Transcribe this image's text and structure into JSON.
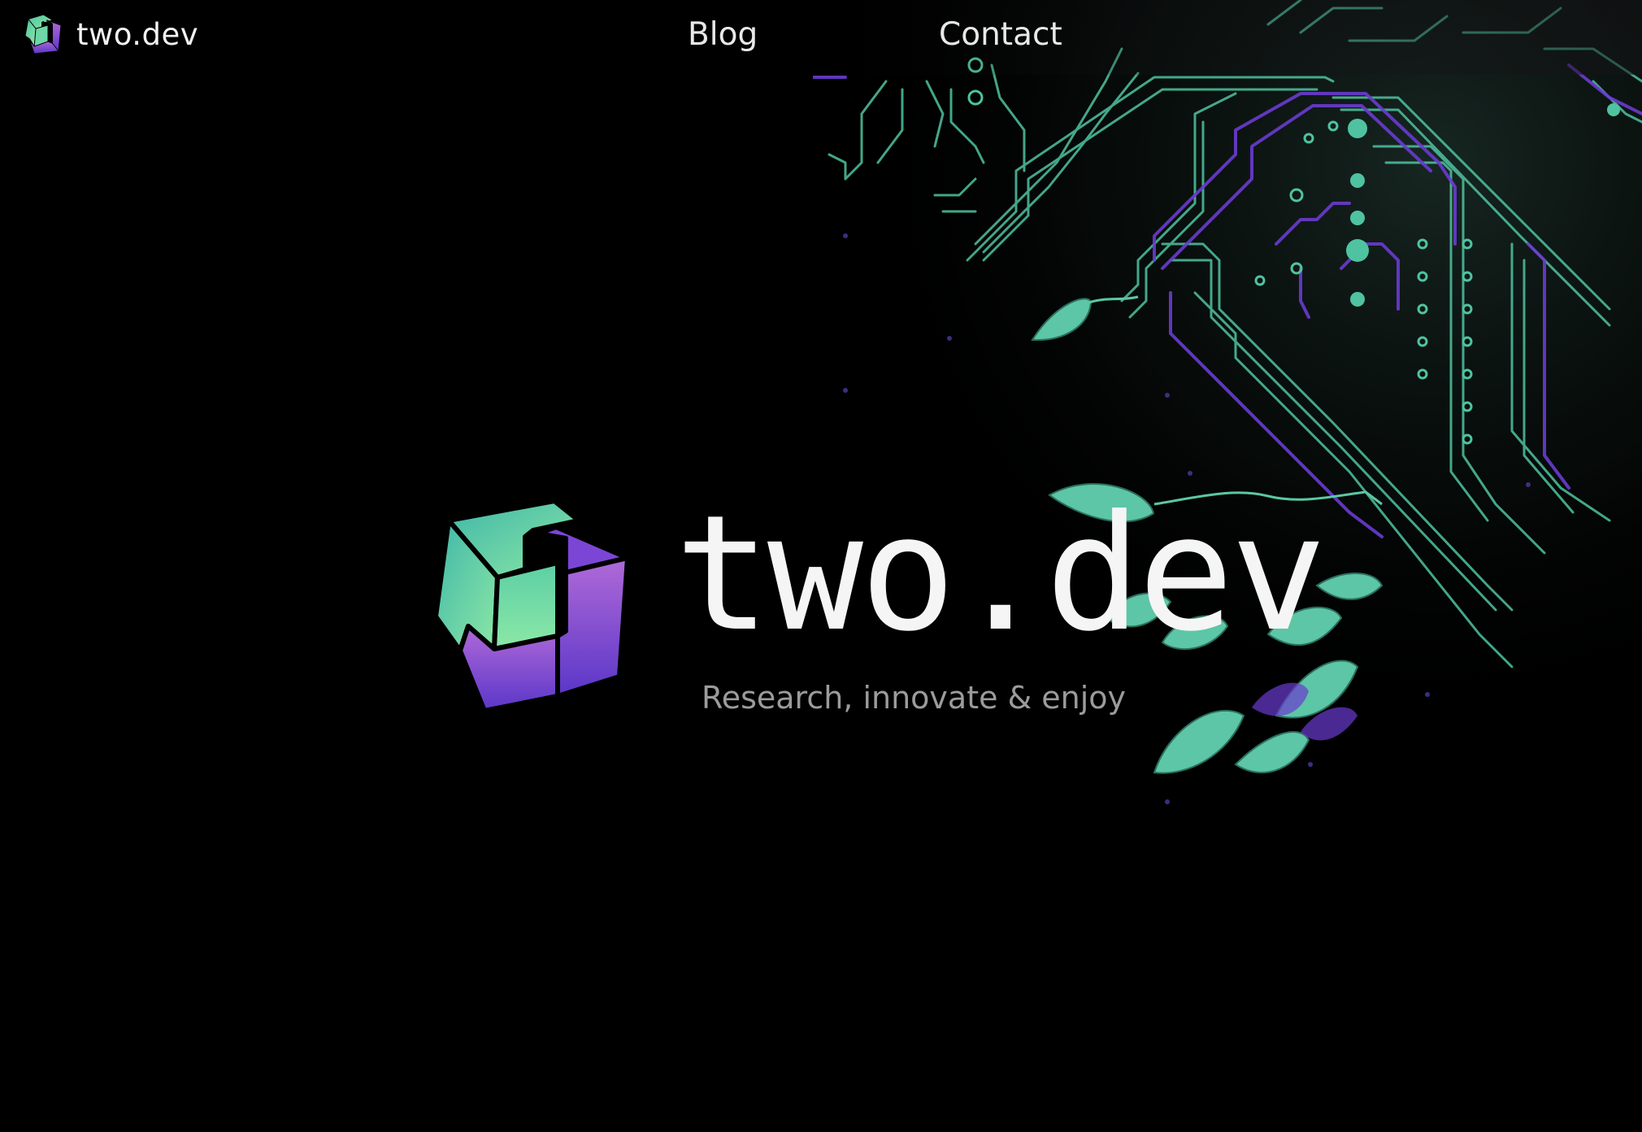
{
  "nav": {
    "brand": "two.dev",
    "links": [
      {
        "label": "Blog"
      },
      {
        "label": "Contact"
      }
    ]
  },
  "hero": {
    "title": "two.dev",
    "tagline": "Research, innovate & enjoy"
  },
  "colors": {
    "background": "#000000",
    "teal": "#4fc3a1",
    "purple": "#6a3bd0",
    "cube_teal_light": "#7fe3b0",
    "cube_purple_light": "#b06ad8"
  },
  "icons": {
    "logo": "two-dev-cube-icon",
    "background_art": "circuit-board-leaves-illustration"
  }
}
